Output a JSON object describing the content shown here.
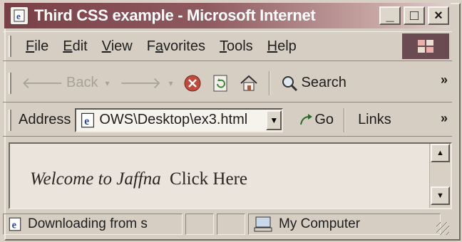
{
  "window": {
    "title": "Third CSS example - Microsoft Internet",
    "controls": {
      "minimize": "_",
      "maximize": "□",
      "close": "×"
    }
  },
  "menu": [
    "File",
    "Edit",
    "View",
    "Favorites",
    "Tools",
    "Help"
  ],
  "menu_mnemonics": [
    "F",
    "E",
    "V",
    "a",
    "T",
    "H"
  ],
  "toolbar": {
    "back_label": "Back",
    "search_label": "Search",
    "overflow": "»"
  },
  "address": {
    "label": "Address",
    "value": "OWS\\Desktop\\ex3.html",
    "go_label": "Go",
    "links_label": "Links"
  },
  "content": {
    "welcome_text": "Welcome to Jaffna",
    "link_text": "Click Here"
  },
  "status": {
    "message": "Downloading from s",
    "zone": "My Computer"
  },
  "colors": {
    "title_active": "#7a3f46",
    "face": "#d6cec2",
    "content_bg": "#eae4dc"
  }
}
